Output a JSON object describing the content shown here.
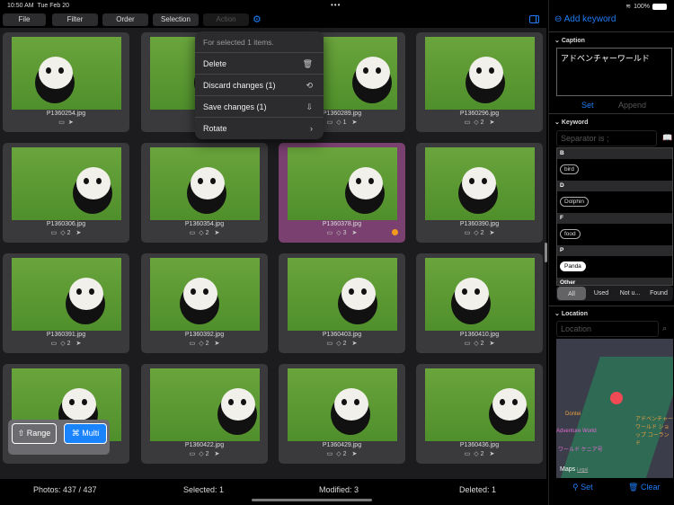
{
  "status": {
    "time": "10:50 AM",
    "date": "Tue Feb 20",
    "battery": "100%"
  },
  "toolbar": {
    "file": "File",
    "filter": "Filter",
    "order": "Order",
    "selection": "Selection",
    "action": "Action"
  },
  "menu": {
    "header": "For selected 1 items.",
    "items": [
      {
        "label": "Delete",
        "icon": "🗑"
      },
      {
        "label": "Discard changes (1)",
        "icon": "⟲"
      },
      {
        "label": "Save changes (1)",
        "icon": "⇩"
      },
      {
        "label": "Rotate",
        "icon": "›"
      }
    ]
  },
  "photos": [
    {
      "name": "P1360254.jpg",
      "tags": "",
      "selected": false
    },
    {
      "name": "P13",
      "tags": "",
      "selected": false
    },
    {
      "name": "P1360289.jpg",
      "tags": "1",
      "selected": false
    },
    {
      "name": "P1360296.jpg",
      "tags": "2",
      "selected": false
    },
    {
      "name": "P1360306.jpg",
      "tags": "2",
      "selected": false
    },
    {
      "name": "P1360354.jpg",
      "tags": "2",
      "selected": false
    },
    {
      "name": "P1360378.jpg",
      "tags": "3",
      "selected": true,
      "modified": true
    },
    {
      "name": "P1360390.jpg",
      "tags": "2",
      "selected": false
    },
    {
      "name": "P1360391.jpg",
      "tags": "2",
      "selected": false
    },
    {
      "name": "P1360392.jpg",
      "tags": "2",
      "selected": false
    },
    {
      "name": "P1360403.jpg",
      "tags": "2",
      "selected": false
    },
    {
      "name": "P1360410.jpg",
      "tags": "2",
      "selected": false
    },
    {
      "name": "",
      "tags": "",
      "selected": false
    },
    {
      "name": "P1360422.jpg",
      "tags": "2",
      "selected": false
    },
    {
      "name": "P1360429.jpg",
      "tags": "2",
      "selected": false
    },
    {
      "name": "P1360436.jpg",
      "tags": "2",
      "selected": false
    }
  ],
  "mode": {
    "range": "Range",
    "multi": "Multi"
  },
  "footer": {
    "photos": "Photos: 437 / 437",
    "selected": "Selected: 1",
    "modified": "Modified: 3",
    "deleted": "Deleted: 1"
  },
  "side": {
    "add_keyword": "Add keyword",
    "caption_title": "Caption",
    "caption": "アドベンチャーワールド",
    "set": "Set",
    "append": "Append",
    "keyword_title": "Keyword",
    "keyword_placeholder": "Separator is ;",
    "groups": [
      {
        "h": "B",
        "k": "bird"
      },
      {
        "h": "D",
        "k": "Dolphin"
      },
      {
        "h": "F",
        "k": "food"
      },
      {
        "h": "P",
        "k": "Panda"
      },
      {
        "h": "Other",
        "k": ""
      }
    ],
    "filters": [
      "All",
      "Used",
      "Not u...",
      "Found"
    ],
    "location_title": "Location",
    "location_placeholder": "Location",
    "map_labels": {
      "dontei": "Dontei",
      "aw": "Adventure World",
      "kenya": "ワールド ケニア号",
      "shop": "アドベンチャーワールド ショップ コーランド",
      "maps": "Maps",
      "legal": "Legal"
    },
    "loc_set": "Set",
    "loc_clear": "Clear"
  },
  "colors": {
    "accent": "#1e7cf5",
    "selected": "#7a4070",
    "modified": "#f39a1c"
  }
}
